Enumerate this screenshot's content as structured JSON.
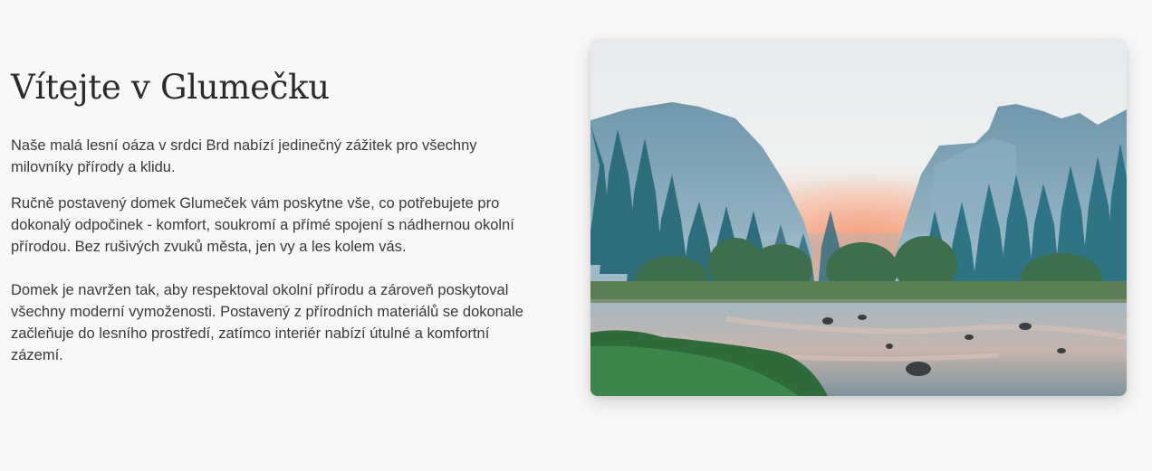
{
  "welcome": {
    "title": "Vítejte v Glumečku",
    "intro": "Naše malá lesní oáza v srdci Brd nabízí jedinečný zážitek pro všechny\nmilovníky přírody a klidu.",
    "body": "Ručně postavený domek Glumeček vám poskytne vše, co potřebujete pro\ndokonalý odpočinek - komfort, soukromí a přímé spojení s nádhernou okolní\npřírodou. Bez rušivých zvuků města, jen vy a les kolem vás.\n\nDomek je navržen tak, aby respektoval okolní přírodu a zároveň poskytoval\nvšechny moderní vymoženosti. Postavený z přírodních materiálů se dokonale\nzačleňuje do lesního prostředí, zatímco interiér nabízí útulné a komfortní\nzázemí."
  },
  "hero_image": {
    "icon": "landscape-photo",
    "colors": {
      "sky_top": "#e4e9ec",
      "sky_glow": "#f4a884",
      "mountain": "#7fa6b8",
      "forest": "#2e6f7e",
      "river": "#8fa8b4",
      "grass": "#3f8a4e"
    }
  }
}
